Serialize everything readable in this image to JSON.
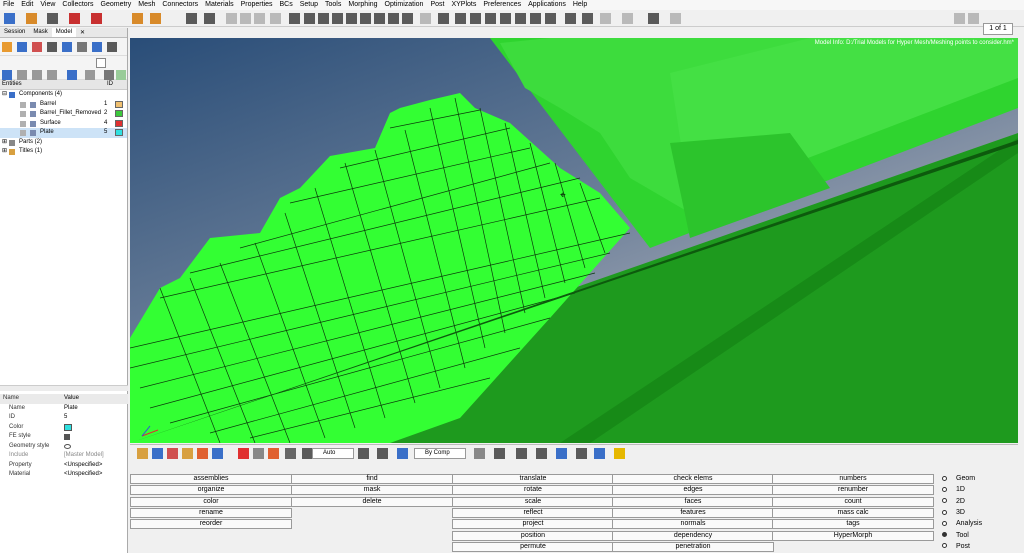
{
  "menu": [
    "File",
    "Edit",
    "View",
    "Collectors",
    "Geometry",
    "Mesh",
    "Connectors",
    "Materials",
    "Properties",
    "BCs",
    "Setup",
    "Tools",
    "Morphing",
    "Optimization",
    "Post",
    "XYPlots",
    "Preferences",
    "Applications",
    "Help"
  ],
  "pager": {
    "value": "1 of 1"
  },
  "tabs": [
    "Session",
    "Mask",
    "Model"
  ],
  "entities_header": {
    "title": "Entities",
    "id": "ID"
  },
  "tree": {
    "components": "Components (4)",
    "items": [
      {
        "label": "Barrel",
        "id": "1",
        "color": "#f0c070"
      },
      {
        "label": "Barrel_Fillet_Removed",
        "id": "2",
        "color": "#3cc83c"
      },
      {
        "label": "Surface",
        "id": "4",
        "color": "#e03030"
      },
      {
        "label": "Plate",
        "id": "5",
        "color": "#30e0e0"
      }
    ],
    "parts": "Parts (2)",
    "titles": "Titles (1)"
  },
  "props_header": {
    "name": "Name",
    "value": "Value"
  },
  "props": [
    {
      "name": "Name",
      "value": "Plate"
    },
    {
      "name": "ID",
      "value": "5"
    },
    {
      "name": "Color",
      "value": ""
    },
    {
      "name": "FE style",
      "value": ""
    },
    {
      "name": "Geometry style",
      "value": ""
    },
    {
      "name": "Include",
      "value": "[Master Model]"
    },
    {
      "name": "Property",
      "value": "<Unspecified>"
    },
    {
      "name": "Material",
      "value": "<Unspecified>"
    }
  ],
  "viewport": {
    "model_info": "Model Info: D:/Trial Models for Hyper Mesh/Meshing points to consider.hm*"
  },
  "bottom_toolbar": {
    "auto": "Auto",
    "bycomp": "By Comp"
  },
  "commands": {
    "col1": [
      "assemblies",
      "organize",
      "color",
      "rename",
      "reorder"
    ],
    "col2": [
      "find",
      "mask",
      "delete"
    ],
    "col3": [
      "translate",
      "rotate",
      "scale",
      "reflect",
      "project",
      "position",
      "permute"
    ],
    "col4": [
      "check elems",
      "edges",
      "faces",
      "features",
      "normals",
      "dependency",
      "penetration"
    ],
    "col5": [
      "numbers",
      "renumber",
      "count",
      "mass calc",
      "tags",
      "HyperMorph"
    ]
  },
  "modes": [
    {
      "label": "Geom",
      "on": false
    },
    {
      "label": "1D",
      "on": false
    },
    {
      "label": "2D",
      "on": false
    },
    {
      "label": "3D",
      "on": false
    },
    {
      "label": "Analysis",
      "on": false
    },
    {
      "label": "Tool",
      "on": true
    },
    {
      "label": "Post",
      "on": false
    }
  ]
}
